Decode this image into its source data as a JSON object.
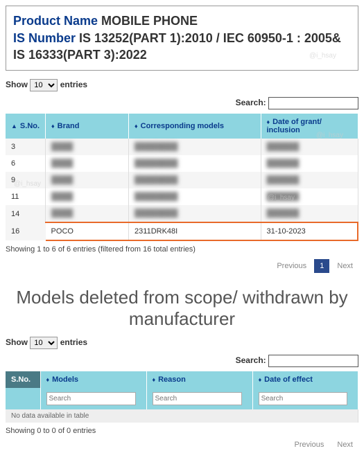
{
  "header": {
    "product_name_label": "Product Name",
    "product_name_value": "MOBILE PHONE",
    "is_number_label": "IS Number",
    "is_number_value": "IS 13252(PART 1):2010 / IEC 60950-1 : 2005& IS 16333(PART 3):2022"
  },
  "watermark": "@i_hsay",
  "table1": {
    "show_label_prefix": "Show",
    "show_label_suffix": "entries",
    "show_value": "10",
    "search_label": "Search:",
    "columns": [
      "S.No.",
      "Brand",
      "Corresponding models",
      "Date of grant/ inclusion"
    ],
    "rows": [
      {
        "sno": "3",
        "brand": "",
        "models": "",
        "date": "",
        "blur": true
      },
      {
        "sno": "6",
        "brand": "",
        "models": "",
        "date": "",
        "blur": true
      },
      {
        "sno": "9",
        "brand": "",
        "models": "",
        "date": "",
        "blur": true
      },
      {
        "sno": "11",
        "brand": "",
        "models": "",
        "date": "",
        "blur": true
      },
      {
        "sno": "14",
        "brand": "",
        "models": "",
        "date": "",
        "blur": true
      },
      {
        "sno": "16",
        "brand": "POCO",
        "models": "2311DRK48I",
        "date": "31-10-2023",
        "highlight": true
      }
    ],
    "info": "Showing 1 to 6 of 6 entries (filtered from 16 total entries)",
    "prev": "Previous",
    "next": "Next",
    "page": "1"
  },
  "section2_title": "Models deleted from scope/ withdrawn by manufacturer",
  "table2": {
    "show_label_prefix": "Show",
    "show_label_suffix": "entries",
    "show_value": "10",
    "search_label": "Search:",
    "columns": [
      "S.No.",
      "Models",
      "Reason",
      "Date of effect"
    ],
    "filter_placeholder": "Search",
    "no_data": "No data available in table",
    "info": "Showing 0 to 0 of 0 entries",
    "prev": "Previous",
    "next": "Next"
  }
}
